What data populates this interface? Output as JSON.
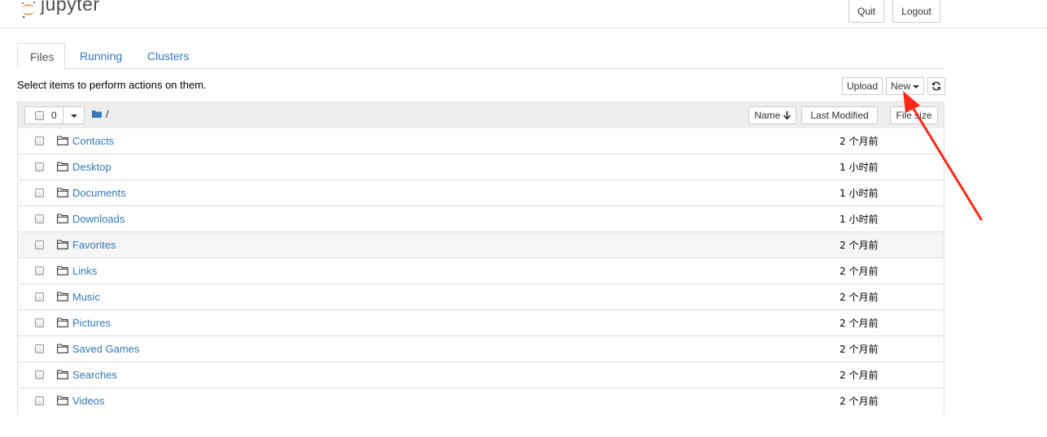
{
  "header": {
    "logo_text": "jupyter",
    "quit_label": "Quit",
    "logout_label": "Logout"
  },
  "tabs": [
    {
      "label": "Files",
      "active": true
    },
    {
      "label": "Running",
      "active": false
    },
    {
      "label": "Clusters",
      "active": false
    }
  ],
  "toolbar": {
    "hint": "Select items to perform actions on them.",
    "upload_label": "Upload",
    "new_label": "New",
    "refresh_icon": "refresh-icon"
  },
  "list_header": {
    "selected_count": "0",
    "path": "/",
    "sort_name": "Name",
    "sort_modified": "Last Modified",
    "sort_size": "File size"
  },
  "items": [
    {
      "name": "Contacts",
      "modified": "2 个月前"
    },
    {
      "name": "Desktop",
      "modified": "1 小时前"
    },
    {
      "name": "Documents",
      "modified": "1 小时前"
    },
    {
      "name": "Downloads",
      "modified": "1 小时前"
    },
    {
      "name": "Favorites",
      "modified": "2 个月前"
    },
    {
      "name": "Links",
      "modified": "2 个月前"
    },
    {
      "name": "Music",
      "modified": "2 个月前"
    },
    {
      "name": "Pictures",
      "modified": "2 个月前"
    },
    {
      "name": "Saved Games",
      "modified": "2 个月前"
    },
    {
      "name": "Searches",
      "modified": "2 个月前"
    },
    {
      "name": "Videos",
      "modified": "2 个月前"
    }
  ],
  "colors": {
    "link": "#337ab7",
    "annotation_arrow": "#ff2a1a",
    "logo_orange": "#f37726"
  }
}
